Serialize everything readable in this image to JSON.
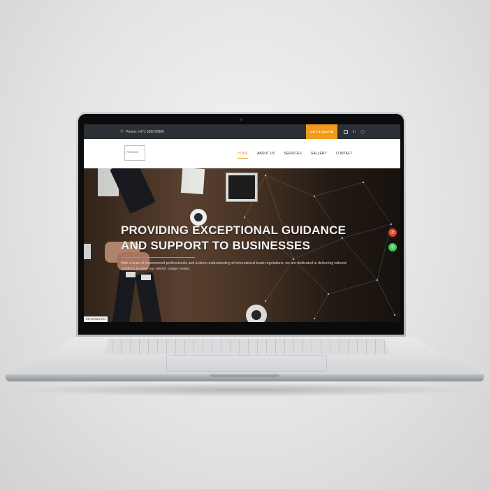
{
  "topbar": {
    "phone_icon": "phone-icon",
    "phone_text": "Phone: +971 585078880",
    "quote_label": "GET A QUOTE",
    "socials": [
      "instagram-icon",
      "linkedin-icon",
      "whatsapp-icon"
    ]
  },
  "nav": {
    "logo_text": "PREMIUS",
    "items": [
      "HOME",
      "ABOUT US",
      "SERVICES",
      "GALLERY",
      "CONTACT"
    ],
    "active": "HOME"
  },
  "hero": {
    "title": "PROVIDING EXCEPTIONAL GUIDANCE AND SUPPORT TO BUSINESSES",
    "description": "With a team of experienced professionals and a deep understanding of international trade regulations, we are dedicated to delivering tailored solutions to meet our clients' unique needs.",
    "info_tab": "INFORMATION"
  },
  "colors": {
    "accent": "#f29a1a",
    "topbar_bg": "#2b3037",
    "call_button": "#e23c2f",
    "whatsapp_button": "#39c85a"
  }
}
